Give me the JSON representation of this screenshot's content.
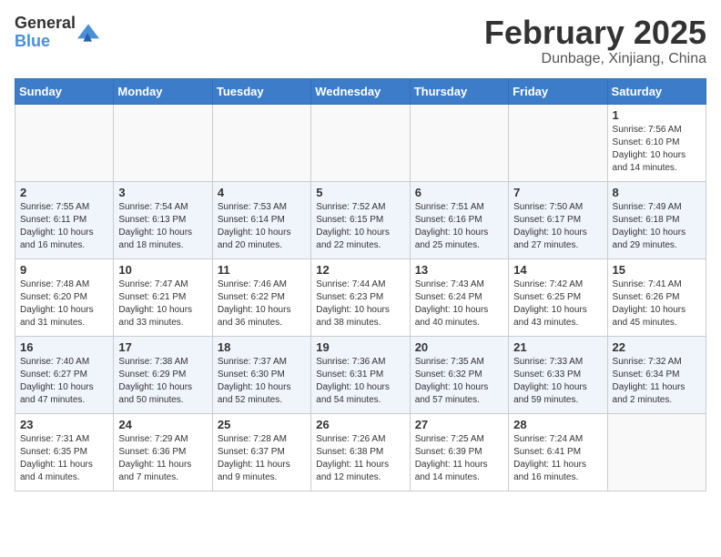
{
  "header": {
    "logo_line1": "General",
    "logo_line2": "Blue",
    "month": "February 2025",
    "location": "Dunbage, Xinjiang, China"
  },
  "weekdays": [
    "Sunday",
    "Monday",
    "Tuesday",
    "Wednesday",
    "Thursday",
    "Friday",
    "Saturday"
  ],
  "weeks": [
    [
      {
        "day": "",
        "info": ""
      },
      {
        "day": "",
        "info": ""
      },
      {
        "day": "",
        "info": ""
      },
      {
        "day": "",
        "info": ""
      },
      {
        "day": "",
        "info": ""
      },
      {
        "day": "",
        "info": ""
      },
      {
        "day": "1",
        "info": "Sunrise: 7:56 AM\nSunset: 6:10 PM\nDaylight: 10 hours\nand 14 minutes."
      }
    ],
    [
      {
        "day": "2",
        "info": "Sunrise: 7:55 AM\nSunset: 6:11 PM\nDaylight: 10 hours\nand 16 minutes."
      },
      {
        "day": "3",
        "info": "Sunrise: 7:54 AM\nSunset: 6:13 PM\nDaylight: 10 hours\nand 18 minutes."
      },
      {
        "day": "4",
        "info": "Sunrise: 7:53 AM\nSunset: 6:14 PM\nDaylight: 10 hours\nand 20 minutes."
      },
      {
        "day": "5",
        "info": "Sunrise: 7:52 AM\nSunset: 6:15 PM\nDaylight: 10 hours\nand 22 minutes."
      },
      {
        "day": "6",
        "info": "Sunrise: 7:51 AM\nSunset: 6:16 PM\nDaylight: 10 hours\nand 25 minutes."
      },
      {
        "day": "7",
        "info": "Sunrise: 7:50 AM\nSunset: 6:17 PM\nDaylight: 10 hours\nand 27 minutes."
      },
      {
        "day": "8",
        "info": "Sunrise: 7:49 AM\nSunset: 6:18 PM\nDaylight: 10 hours\nand 29 minutes."
      }
    ],
    [
      {
        "day": "9",
        "info": "Sunrise: 7:48 AM\nSunset: 6:20 PM\nDaylight: 10 hours\nand 31 minutes."
      },
      {
        "day": "10",
        "info": "Sunrise: 7:47 AM\nSunset: 6:21 PM\nDaylight: 10 hours\nand 33 minutes."
      },
      {
        "day": "11",
        "info": "Sunrise: 7:46 AM\nSunset: 6:22 PM\nDaylight: 10 hours\nand 36 minutes."
      },
      {
        "day": "12",
        "info": "Sunrise: 7:44 AM\nSunset: 6:23 PM\nDaylight: 10 hours\nand 38 minutes."
      },
      {
        "day": "13",
        "info": "Sunrise: 7:43 AM\nSunset: 6:24 PM\nDaylight: 10 hours\nand 40 minutes."
      },
      {
        "day": "14",
        "info": "Sunrise: 7:42 AM\nSunset: 6:25 PM\nDaylight: 10 hours\nand 43 minutes."
      },
      {
        "day": "15",
        "info": "Sunrise: 7:41 AM\nSunset: 6:26 PM\nDaylight: 10 hours\nand 45 minutes."
      }
    ],
    [
      {
        "day": "16",
        "info": "Sunrise: 7:40 AM\nSunset: 6:27 PM\nDaylight: 10 hours\nand 47 minutes."
      },
      {
        "day": "17",
        "info": "Sunrise: 7:38 AM\nSunset: 6:29 PM\nDaylight: 10 hours\nand 50 minutes."
      },
      {
        "day": "18",
        "info": "Sunrise: 7:37 AM\nSunset: 6:30 PM\nDaylight: 10 hours\nand 52 minutes."
      },
      {
        "day": "19",
        "info": "Sunrise: 7:36 AM\nSunset: 6:31 PM\nDaylight: 10 hours\nand 54 minutes."
      },
      {
        "day": "20",
        "info": "Sunrise: 7:35 AM\nSunset: 6:32 PM\nDaylight: 10 hours\nand 57 minutes."
      },
      {
        "day": "21",
        "info": "Sunrise: 7:33 AM\nSunset: 6:33 PM\nDaylight: 10 hours\nand 59 minutes."
      },
      {
        "day": "22",
        "info": "Sunrise: 7:32 AM\nSunset: 6:34 PM\nDaylight: 11 hours\nand 2 minutes."
      }
    ],
    [
      {
        "day": "23",
        "info": "Sunrise: 7:31 AM\nSunset: 6:35 PM\nDaylight: 11 hours\nand 4 minutes."
      },
      {
        "day": "24",
        "info": "Sunrise: 7:29 AM\nSunset: 6:36 PM\nDaylight: 11 hours\nand 7 minutes."
      },
      {
        "day": "25",
        "info": "Sunrise: 7:28 AM\nSunset: 6:37 PM\nDaylight: 11 hours\nand 9 minutes."
      },
      {
        "day": "26",
        "info": "Sunrise: 7:26 AM\nSunset: 6:38 PM\nDaylight: 11 hours\nand 12 minutes."
      },
      {
        "day": "27",
        "info": "Sunrise: 7:25 AM\nSunset: 6:39 PM\nDaylight: 11 hours\nand 14 minutes."
      },
      {
        "day": "28",
        "info": "Sunrise: 7:24 AM\nSunset: 6:41 PM\nDaylight: 11 hours\nand 16 minutes."
      },
      {
        "day": "",
        "info": ""
      }
    ]
  ]
}
